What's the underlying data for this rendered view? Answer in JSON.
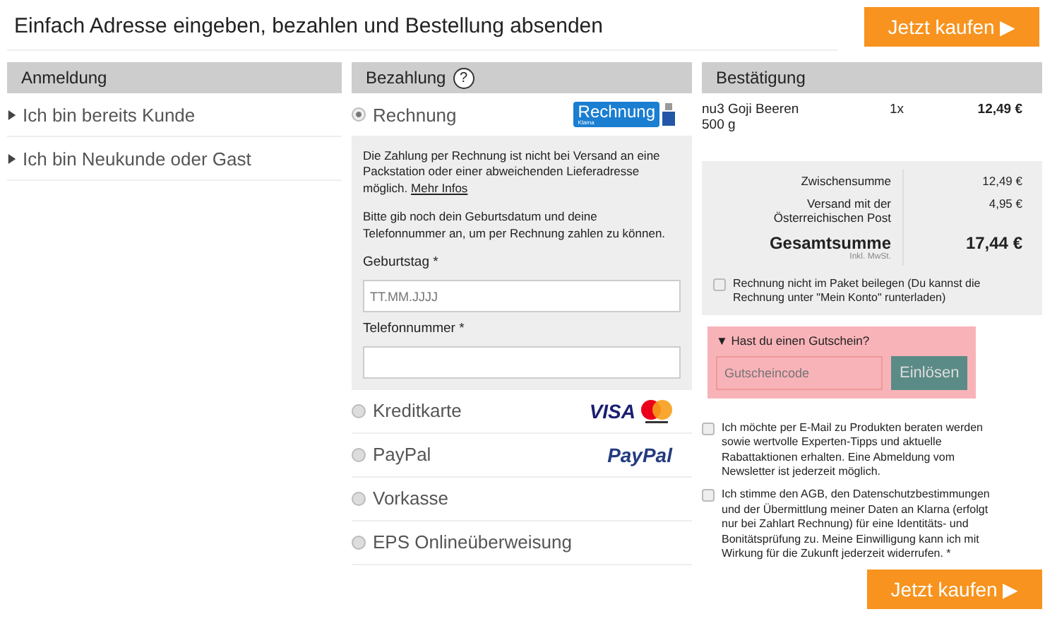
{
  "header": {
    "title": "Einfach Adresse eingeben, bezahlen und Bestellung absenden",
    "buy_button": "Jetzt kaufen ▶"
  },
  "login": {
    "title": "Anmeldung",
    "items": [
      {
        "label": "Ich bin bereits Kunde",
        "expanded": false
      },
      {
        "label": "Ich bin Neukunde oder Gast",
        "expanded": false
      }
    ]
  },
  "payment": {
    "title": "Bezahlung",
    "help": "?",
    "methods": [
      {
        "label": "Rechnung",
        "selected": true,
        "kind": "klarna",
        "logo_text": "Rechnung",
        "logo_subtext": "Klarna",
        "details": {
          "notice": "Die Zahlung per Rechnung ist nicht bei Versand an eine Packstation oder einer abweichenden Lieferadresse möglich.",
          "link": "Mehr Infos",
          "hint": "Bitte gib noch dein Geburtsdatum und deine Telefonnummer an, um per Rechnung zahlen zu können.",
          "fields": [
            {
              "label": "Geburtstag *",
              "placeholder": "TT.MM.JJJJ"
            },
            {
              "label": "Telefonnummer *"
            }
          ]
        }
      },
      {
        "label": "Kreditkarte",
        "selected": false,
        "kind": "visa",
        "logo_text": "VISA"
      },
      {
        "label": "PayPal",
        "selected": false,
        "kind": "paypal",
        "logo_text": "PayPal"
      },
      {
        "label": "Vorkasse",
        "selected": false
      },
      {
        "label": "EPS Onlineüberweisung",
        "selected": false
      }
    ]
  },
  "confirmation": {
    "title": "Bestätigung",
    "items": [
      {
        "name": "nu3 Goji Beeren 500 g",
        "qty": "1x",
        "price": "12,49 €"
      }
    ],
    "totals": [
      {
        "label": "Zwischensumme",
        "value": "12,49 €"
      },
      {
        "label": "Versand mit der Österreichischen Post",
        "value": "4,95 €"
      }
    ],
    "grand_total": {
      "label": "Gesamtsumme",
      "note": "Inkl. MwSt.",
      "value": "17,44 €"
    },
    "invoice_option": {
      "label": "Rechnung nicht im Paket beilegen (Du kannst die Rechnung unter \"Mein Konto\" runterladen)",
      "checked": false
    },
    "voucher": {
      "toggle": "▼ Hast du einen Gutschein?",
      "placeholder": "Gutscheincode",
      "button": "Einlösen"
    },
    "consents": [
      {
        "label": "Ich möchte per E-Mail zu Produkten beraten werden sowie wertvolle Experten-Tipps und aktuelle Rabattaktionen erhalten. Eine Abmeldung vom Newsletter ist jederzeit möglich.",
        "checked": false
      },
      {
        "label": "Ich stimme den AGB, den Datenschutzbestimmungen und der Übermittlung meiner Daten an Klarna (erfolgt nur bei Zahlart Rechnung) für eine Identitäts- und Bonitätsprüfung zu. Meine Einwilligung kann ich mit Wirkung für die Zukunft jederzeit widerrufen. *",
        "checked": false
      }
    ],
    "buy_button": "Jetzt kaufen ▶"
  }
}
